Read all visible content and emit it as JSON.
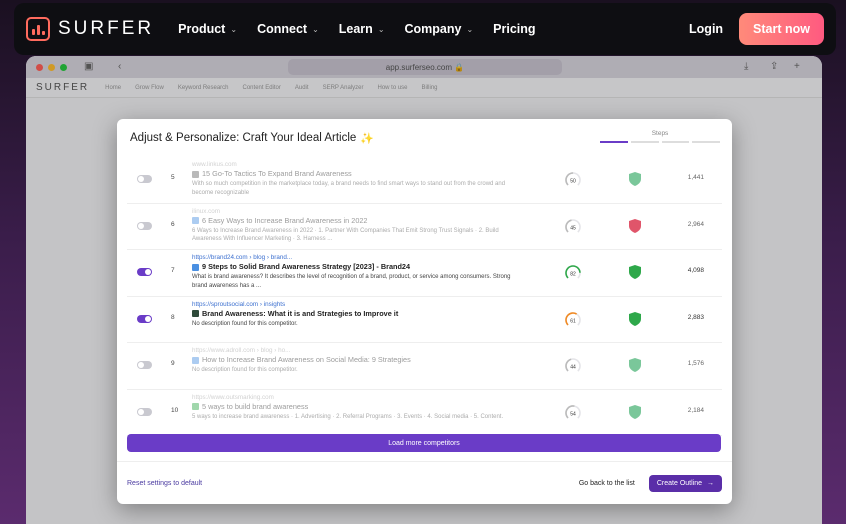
{
  "site": {
    "logo_text": "SURFER",
    "nav": [
      {
        "label": "Product"
      },
      {
        "label": "Connect"
      },
      {
        "label": "Learn"
      },
      {
        "label": "Company"
      },
      {
        "label": "Pricing"
      }
    ],
    "login": "Login",
    "start": "Start now"
  },
  "browser": {
    "url": "app.surferseo.com 🔒"
  },
  "app": {
    "logo_text": "SURFER",
    "tabs": [
      "Home",
      "Grow Flow",
      "Keyword Research",
      "Content Editor",
      "Audit",
      "SERP Analyzer",
      "How to use",
      "Billing"
    ]
  },
  "modal": {
    "title": "Adjust & Personalize: Craft Your Ideal Article",
    "spark": "✨",
    "steps_label": "Steps",
    "rows": [
      {
        "on": false,
        "rank": "5",
        "source": "www.linkus.com",
        "title": "15 Go-To Tactics To Expand Brand Awareness",
        "desc": "With so much competition in the marketplace today, a brand needs to find smart ways to stand out from the crowd and become recognizable",
        "score": "50",
        "words": "1,441",
        "fav": "#666666",
        "shield": "#7ac79a",
        "gauge": "#bbbbbb"
      },
      {
        "on": false,
        "rank": "6",
        "source": "ilinux.com",
        "title": "6 Easy Ways to Increase Brand Awareness in 2022",
        "desc": "6 Ways to Increase Brand Awareness in 2022 · 1. Partner With Companies That Emit Strong Trust Signals · 2. Build Awareness With Influencer Marketing · 3. Harness ...",
        "score": "45",
        "words": "2,964",
        "fav": "#4a90e2",
        "shield": "#e0556a",
        "gauge": "#bbbbbb"
      },
      {
        "on": true,
        "rank": "7",
        "source": "https://brand24.com › blog › brand...",
        "title": "9 Steps to Solid Brand Awareness Strategy [2023] - Brand24",
        "desc": "What is brand awareness? It describes the level of recognition of a brand, product, or service among consumers. Strong brand awareness has a ...",
        "score": "82",
        "words": "4,098",
        "fav": "#4a90e2",
        "shield": "#2ea84a",
        "gauge": "#2ea84a"
      },
      {
        "on": true,
        "rank": "8",
        "source": "https://sproutsocial.com › insights",
        "title": "Brand Awareness: What it is and Strategies to Improve it",
        "desc": "No description found for this competitor.",
        "score": "61",
        "words": "2,883",
        "fav": "#2e4a3a",
        "shield": "#2ea84a",
        "gauge": "#f08a24"
      },
      {
        "on": false,
        "rank": "9",
        "source": "https://www.adroll.com › blog › ho...",
        "title": "How to Increase Brand Awareness on Social Media: 9 Strategies",
        "desc": "No description found for this competitor.",
        "score": "44",
        "words": "1,576",
        "fav": "#4a90e2",
        "shield": "#7ac79a",
        "gauge": "#bbbbbb"
      },
      {
        "on": false,
        "rank": "10",
        "source": "https://www.outsmarking.com",
        "title": "5 ways to build brand awareness",
        "desc": "5 ways to increase brand awareness · 1. Advertising · 2. Referral Programs · 3. Events · 4. Social media · 5. Content.",
        "score": "54",
        "words": "2,184",
        "fav": "#2ea84a",
        "shield": "#7ac79a",
        "gauge": "#bbbbbb"
      }
    ],
    "load_more": "Load more competitors",
    "reset": "Reset settings to default",
    "back": "Go back to the list",
    "create": "Create Outline"
  }
}
